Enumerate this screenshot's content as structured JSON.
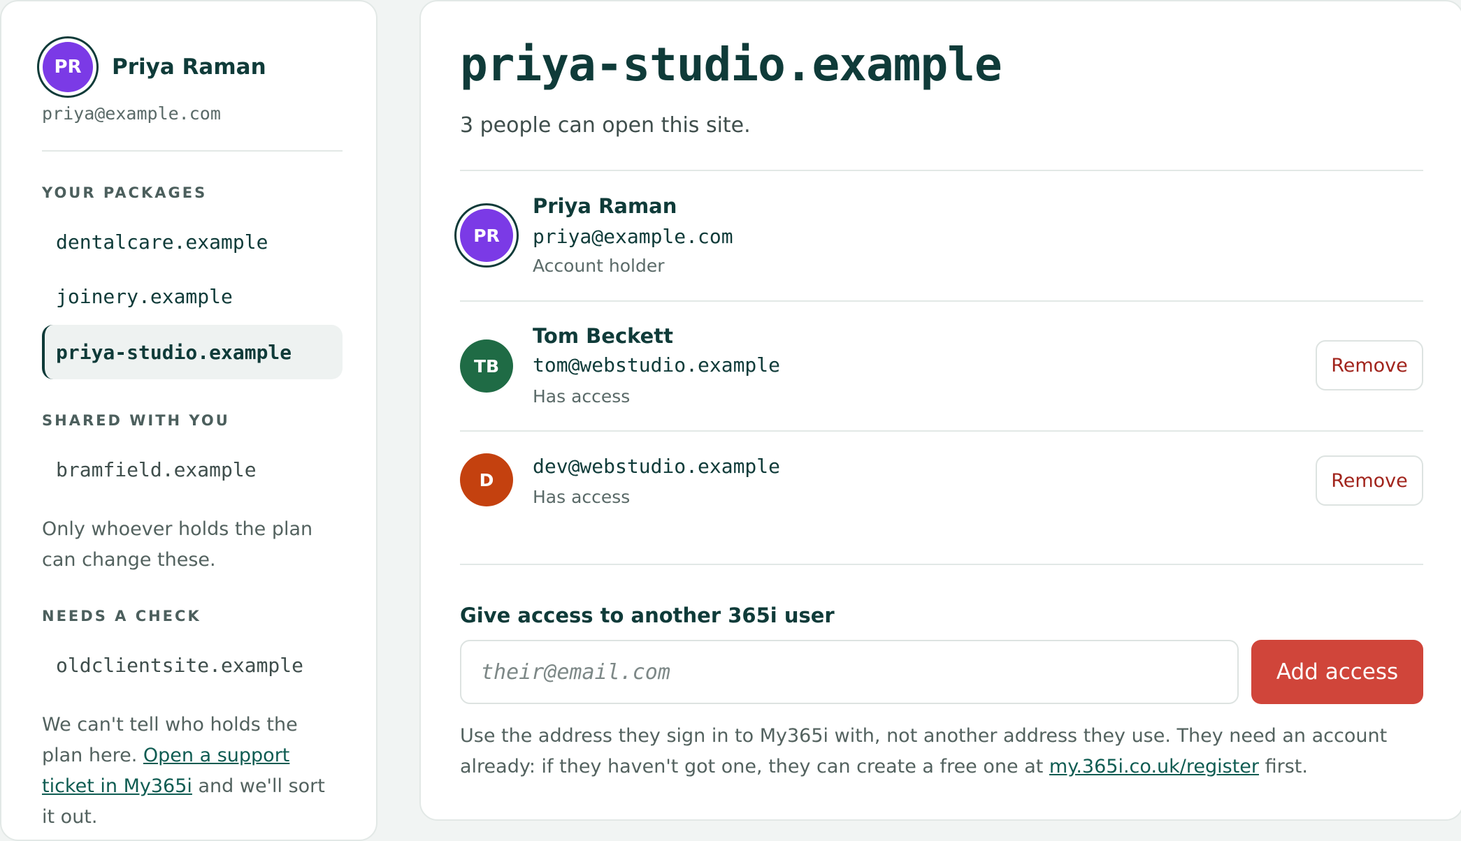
{
  "account": {
    "initials": "PR",
    "name": "Priya Raman",
    "email": "priya@example.com"
  },
  "sidebar": {
    "packages_heading": "YOUR PACKAGES",
    "packages": [
      "dentalcare.example",
      "joinery.example",
      "priya-studio.example"
    ],
    "active_package": "priya-studio.example",
    "shared_heading": "SHARED WITH YOU",
    "shared": [
      "bramfield.example"
    ],
    "shared_note": "Only whoever holds the plan can change these.",
    "check_heading": "NEEDS A CHECK",
    "check": [
      "oldclientsite.example"
    ],
    "check_note_prefix": "We can't tell who holds the plan here. ",
    "check_note_link": "Open a support ticket in My365i",
    "check_note_suffix": " and we'll sort it out."
  },
  "site": {
    "title": "priya-studio.example",
    "subtitle": "3 people can open this site."
  },
  "people": [
    {
      "initials": "PR",
      "name": "Priya Raman",
      "email": "priya@example.com",
      "role": "Account holder",
      "avatar_color": "#7b3ae6"
    },
    {
      "initials": "TB",
      "name": "Tom Beckett",
      "email": "tom@webstudio.example",
      "role": "Has access",
      "avatar_color": "#1f6b45",
      "remove_label": "Remove"
    },
    {
      "initials": "D",
      "email": "dev@webstudio.example",
      "role": "Has access",
      "avatar_color": "#c4410f",
      "remove_label": "Remove"
    }
  ],
  "give_access": {
    "label": "Give access to another 365i user",
    "placeholder": "their@email.com",
    "button": "Add access",
    "help_prefix": "Use the address they sign in to My365i with, not another address they use. They need an account already: if they haven't got one, they can create a free one at ",
    "help_link": "my.365i.co.uk/register",
    "help_suffix": " first."
  },
  "colors": {
    "primary_text": "#0f3b39",
    "accent_red": "#d0453a",
    "remove_text": "#a1241c"
  }
}
